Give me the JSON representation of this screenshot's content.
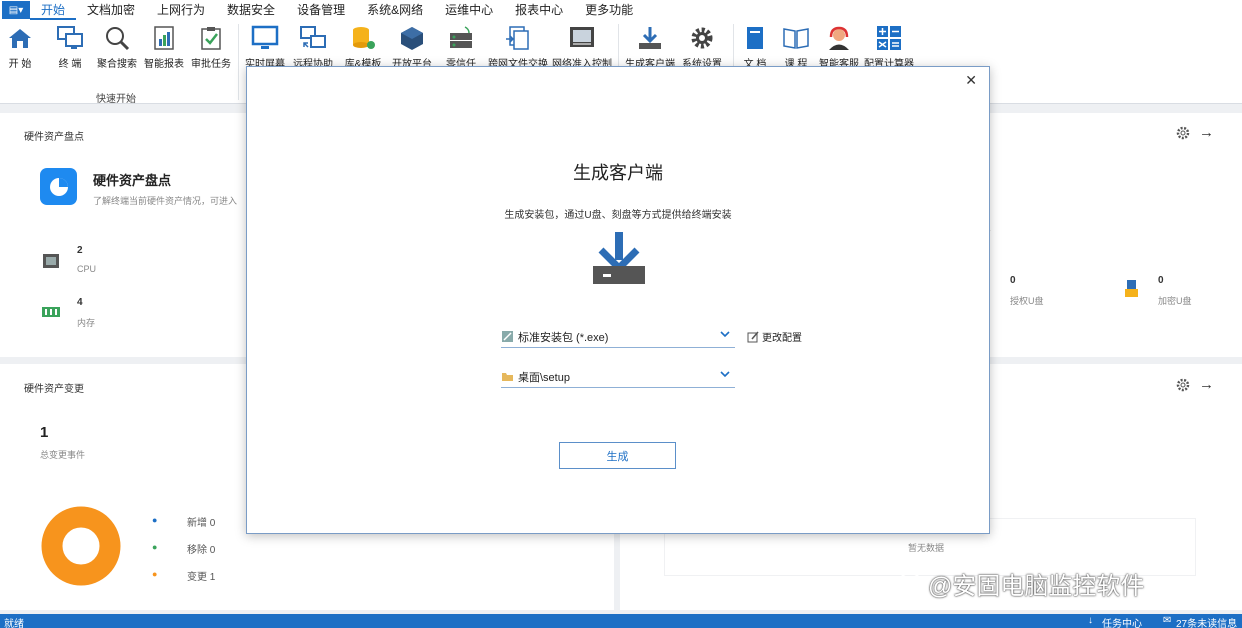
{
  "menu": {
    "items": [
      "开始",
      "文档加密",
      "上网行为",
      "数据安全",
      "设备管理",
      "系统&网络",
      "运维中心",
      "报表中心",
      "更多功能"
    ]
  },
  "ribbon": {
    "buttons": [
      "开 始",
      "终 端",
      "聚合搜索",
      "智能报表",
      "审批任务",
      "实时屏幕",
      "远程协助",
      "库&模板",
      "开放平台",
      "零信任",
      "跨网文件交换",
      "网络准入控制",
      "生成客户端",
      "系统设置",
      "文 档",
      "课 程",
      "智能客服",
      "配置计算器"
    ],
    "group_label": "快速开始"
  },
  "hw_inventory": {
    "title": "硬件资产盘点",
    "header": "硬件资产盘点",
    "desc": "了解终端当前硬件资产情况，可进入",
    "cpu_value": "2",
    "cpu_label": "CPU",
    "mem_value": "4",
    "mem_label": "内存"
  },
  "usb": {
    "auth_value": "0",
    "auth_label": "授权U盘",
    "enc_value": "0",
    "enc_label": "加密U盘"
  },
  "hw_change": {
    "title": "硬件资产变更",
    "total_value": "1",
    "total_label": "总变更事件",
    "legend": [
      "新增 0",
      "移除 0",
      "变更 1"
    ],
    "no_data": "暂无数据"
  },
  "modal": {
    "title": "生成客户端",
    "subtitle": "生成安装包，通过U盘、刻盘等方式提供给终端安装",
    "package_select": "标准安装包 (*.exe)",
    "edit_config": "更改配置",
    "path_select": "桌面\\setup",
    "generate": "生成"
  },
  "status": {
    "ready": "就绪",
    "task_center": "任务中心",
    "unread": "27条未读信息"
  },
  "watermark": "@安固电脑监控软件",
  "colors": {
    "accent": "#1d6fc5",
    "donut": "#f7941d"
  }
}
